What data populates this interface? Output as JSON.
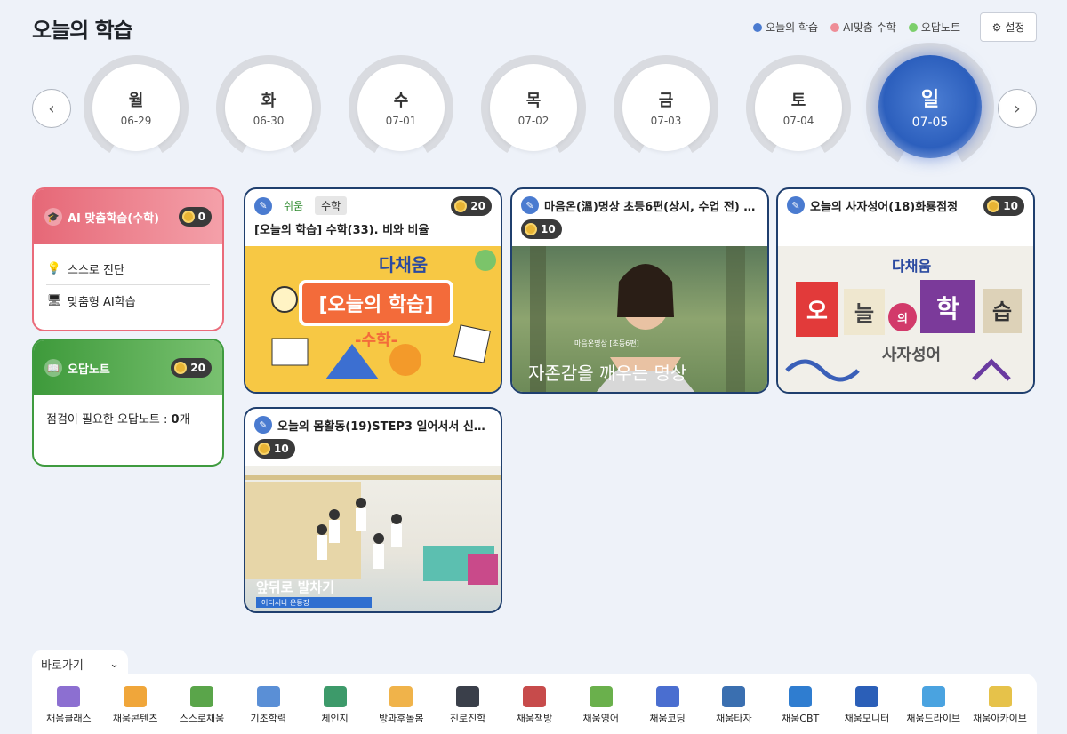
{
  "page": {
    "title": "오늘의 학습",
    "settings_label": "설정"
  },
  "legend": [
    {
      "label": "오늘의 학습",
      "color": "#4a7bd0"
    },
    {
      "label": "AI맞춤 수학",
      "color": "#ee8d97"
    },
    {
      "label": "오답노트",
      "color": "#7ccf6b"
    }
  ],
  "days": [
    {
      "name": "월",
      "date": "06-29"
    },
    {
      "name": "화",
      "date": "06-30"
    },
    {
      "name": "수",
      "date": "07-01"
    },
    {
      "name": "목",
      "date": "07-02"
    },
    {
      "name": "금",
      "date": "07-03"
    },
    {
      "name": "토",
      "date": "07-04"
    },
    {
      "name": "일",
      "date": "07-05",
      "active": true
    }
  ],
  "ai_card": {
    "title": "AI 맞춤학습(수학)",
    "coins": "0",
    "items": [
      "스스로 진단",
      "맞춤형 AI학습"
    ]
  },
  "note_card": {
    "title": "오답노트",
    "coins": "20",
    "text_prefix": "점검이 필요한 오답노트 : ",
    "count": "0",
    "unit": "개"
  },
  "cards": [
    {
      "tag_level": "쉬움",
      "tag_subject": "수학",
      "coins": "20",
      "title": "[오늘의 학습] 수학(33). 비와 비율",
      "thumb_text": "[오늘의 학습]",
      "thumb_sub": "-수학-",
      "brand": "다채움"
    },
    {
      "title": "마음온(溫)명상 초등6편(상시, 수업 전) 자...",
      "coins": "10",
      "thumb_caption": "자존감을 깨우는 명상",
      "thumb_small": "마음온명상 [초등6편]"
    },
    {
      "title": "오늘의 사자성어(18)화룡점정",
      "coins": "10",
      "brand": "다채움",
      "thumb_syllables": [
        "오",
        "늘",
        "의",
        "학",
        "습"
      ],
      "thumb_sub": "사자성어"
    },
    {
      "title": "오늘의 몸활동(19)STEP3 일어서서 신나...",
      "coins": "10",
      "thumb_caption": "앞뒤로 발차기",
      "thumb_small": "어디서나 운동장"
    }
  ],
  "quick": {
    "label": "바로가기"
  },
  "dock": [
    {
      "label": "채움클래스",
      "color": "#8c6fd1"
    },
    {
      "label": "채움콘텐츠",
      "color": "#f0a63a"
    },
    {
      "label": "스스로채움",
      "color": "#5aa54a"
    },
    {
      "label": "기초학력",
      "color": "#5a8fd6"
    },
    {
      "label": "체인지",
      "color": "#3d9a6a"
    },
    {
      "label": "방과후돌봄",
      "color": "#f0b34a"
    },
    {
      "label": "진로진학",
      "color": "#3a3f4a"
    },
    {
      "label": "채움책방",
      "color": "#c74b4b"
    },
    {
      "label": "채움영어",
      "color": "#6ab04c"
    },
    {
      "label": "채움코딩",
      "color": "#4a6ed0"
    },
    {
      "label": "채움타자",
      "color": "#3a6fb0"
    },
    {
      "label": "채움CBT",
      "color": "#2f7dd0"
    },
    {
      "label": "채움모니터",
      "color": "#2b5fb8"
    },
    {
      "label": "채움드라이브",
      "color": "#4aa3e0"
    },
    {
      "label": "채움아카이브",
      "color": "#e6c24a"
    }
  ]
}
